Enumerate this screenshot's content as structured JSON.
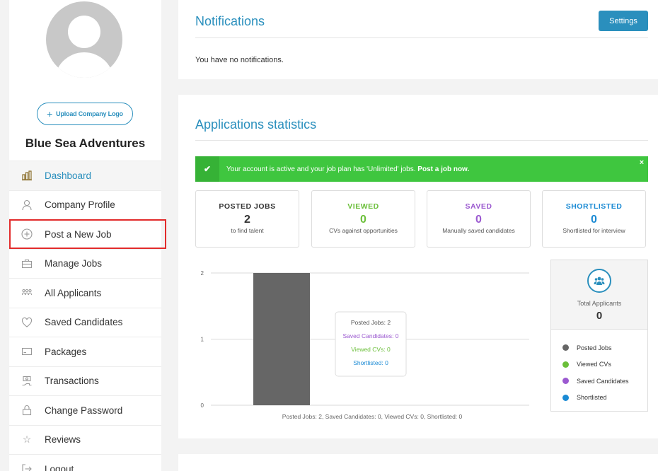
{
  "sidebar": {
    "upload_label": "Upload Company Logo",
    "company_name": "Blue Sea Adventures",
    "items": [
      {
        "label": "Dashboard",
        "icon": "dashboard-icon"
      },
      {
        "label": "Company Profile",
        "icon": "user-icon"
      },
      {
        "label": "Post a New Job",
        "icon": "plus-circle-icon"
      },
      {
        "label": "Manage Jobs",
        "icon": "briefcase-icon"
      },
      {
        "label": "All Applicants",
        "icon": "group-icon"
      },
      {
        "label": "Saved Candidates",
        "icon": "heart-icon"
      },
      {
        "label": "Packages",
        "icon": "package-icon"
      },
      {
        "label": "Transactions",
        "icon": "money-icon"
      },
      {
        "label": "Change Password",
        "icon": "lock-icon"
      },
      {
        "label": "Reviews",
        "icon": "star-icon"
      },
      {
        "label": "Logout",
        "icon": "logout-icon"
      }
    ]
  },
  "notifications": {
    "title": "Notifications",
    "settings_label": "Settings",
    "empty_text": "You have no notifications."
  },
  "stats": {
    "title": "Applications statistics",
    "alert": {
      "text": "Your account is active and your job plan has 'Unlimited' jobs.",
      "link": "Post a job now.",
      "close": "×"
    },
    "boxes": [
      {
        "label": "POSTED JOBS",
        "value": "2",
        "sub": "to find talent",
        "color": "#333333"
      },
      {
        "label": "VIEWED",
        "value": "0",
        "sub": "CVs against opportunities",
        "color": "#6bbf3a"
      },
      {
        "label": "SAVED",
        "value": "0",
        "sub": "Manually saved candidates",
        "color": "#9b59d0"
      },
      {
        "label": "SHORTLISTED",
        "value": "0",
        "sub": "Shortlisted for interview",
        "color": "#1a8ad4"
      }
    ],
    "legend": {
      "total_label": "Total Applicants",
      "total_value": "0",
      "items": [
        {
          "label": "Posted Jobs",
          "color": "#666666"
        },
        {
          "label": "Viewed CVs",
          "color": "#6bbf3a"
        },
        {
          "label": "Saved Candidates",
          "color": "#9b59d0"
        },
        {
          "label": "Shortlisted",
          "color": "#1a8ad4"
        }
      ]
    }
  },
  "chart_data": {
    "type": "bar",
    "categories": [
      ""
    ],
    "series": [
      {
        "name": "Posted Jobs",
        "values": [
          2
        ],
        "color": "#666666"
      },
      {
        "name": "Saved Candidates",
        "values": [
          0
        ],
        "color": "#9b59d0"
      },
      {
        "name": "Viewed CVs",
        "values": [
          0
        ],
        "color": "#6bbf3a"
      },
      {
        "name": "Shortlisted",
        "values": [
          0
        ],
        "color": "#1a8ad4"
      }
    ],
    "ylim": [
      0,
      2
    ],
    "yticks": [
      "0",
      "1",
      "2"
    ],
    "grid": true,
    "tooltip": [
      "Posted Jobs: 2",
      "Saved Candidates: 0",
      "Viewed CVs: 0",
      "Shortlisted: 0"
    ],
    "caption": "Posted Jobs: 2, Saved Candidates: 0, Viewed CVs: 0, Shortlisted: 0"
  }
}
